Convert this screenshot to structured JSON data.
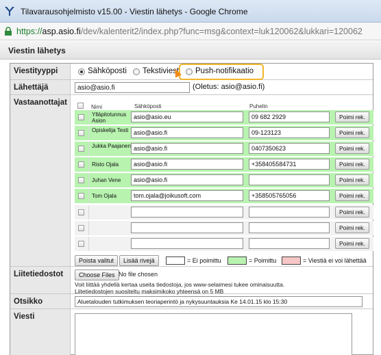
{
  "window": {
    "title": "Tilavarausohjelmisto v15.00 - Viestin lähetys - Google Chrome",
    "url_scheme": "https://",
    "url_host": "asp.asio.fi",
    "url_path": "/dev/kalenterit2/index.php?func=msg&context=luk120062&lukkari=120062"
  },
  "dialog": {
    "title": "Viestin lähetys"
  },
  "message_type": {
    "label": "Viestityyppi",
    "options": [
      "Sähköposti",
      "Tekstiviesti",
      "Push-notifikaatio"
    ],
    "selected": "Sähköposti"
  },
  "sender": {
    "label": "Lähettäjä",
    "value": "asio@asio.fi",
    "default_note": "(Oletus: asio@asio.fi)"
  },
  "recipients": {
    "label": "Vastaanottajat",
    "headers": {
      "name": "Nimi",
      "email": "Sähköposti",
      "phone": "Puhelin"
    },
    "pick_label": "Poimi rek.",
    "rows": [
      {
        "name": "Ylläpitotunnus Asion",
        "email": "asio@asio.eu",
        "phone": "09 682 2929",
        "status": "picked"
      },
      {
        "name": "Opiskelija Testi",
        "email": "asio@asio.fi",
        "phone": "09-123123",
        "status": "picked"
      },
      {
        "name": "Jukka Paajanen",
        "email": "asio@asio.fi",
        "phone": "0407350623",
        "status": "picked"
      },
      {
        "name": "Risto Ojala",
        "email": "asio@asio.fi",
        "phone": "+358405584731",
        "status": "picked"
      },
      {
        "name": "Juhan Vene",
        "email": "asio@asio.fi",
        "phone": "",
        "status": "picked"
      },
      {
        "name": "Tom Ojala",
        "email": "tom.ojala@joikusoft.com",
        "phone": "+358505765056",
        "status": "picked"
      },
      {
        "name": "",
        "email": "",
        "phone": "",
        "status": "empty"
      },
      {
        "name": "",
        "email": "",
        "phone": "",
        "status": "empty"
      },
      {
        "name": "",
        "email": "",
        "phone": "",
        "status": "empty"
      }
    ],
    "remove_selected": "Poista valitut",
    "add_row": "Lisää rivejä",
    "legend": [
      {
        "label": "= Ei poimittu",
        "color": "#ffffff"
      },
      {
        "label": "= Poimittu",
        "color": "#b8f3b0"
      },
      {
        "label": "= Viestiä ei voi lähettää",
        "color": "#f7c6c6"
      }
    ]
  },
  "attachments": {
    "label": "Liitetiedostot",
    "choose_button": "Choose Files",
    "no_file": "No file chosen",
    "note1": "Voit liittää yhdellä kertaa useita tiedostoja, jos www-selaimesi tukee ominaisuutta.",
    "note2": "Liitetiedostojen suositeltu maksimikoko yhteensä on 5 MB"
  },
  "subject": {
    "label": "Otsikko",
    "value": "Aluetalouden tutkimuksen teoriaperintö ja nykysuuntauksia Ke 14.01.15 klo 15:30"
  },
  "message": {
    "label": "Viesti",
    "value": ""
  },
  "colors": {
    "accent_highlight": "#f2b42a",
    "picked_green": "#b8f3b0",
    "error_pink": "#f7c6c6"
  }
}
